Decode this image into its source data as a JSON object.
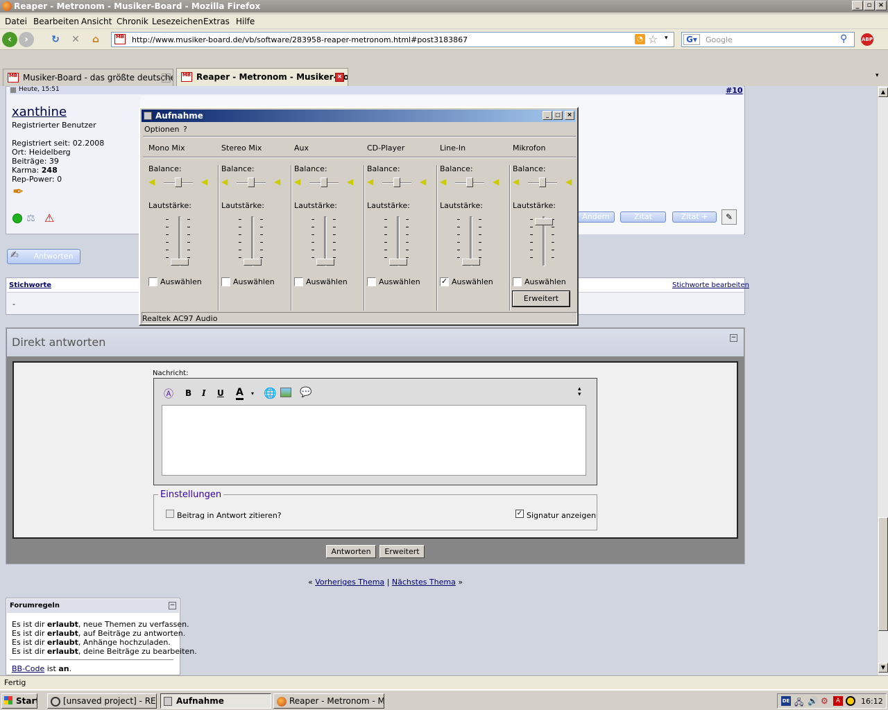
{
  "window": {
    "title": "Reaper - Metronom - Musiker-Board - Mozilla Firefox"
  },
  "menu": [
    "Datei",
    "Bearbeiten",
    "Ansicht",
    "Chronik",
    "Lesezeichen",
    "Extras",
    "Hilfe"
  ],
  "nav": {
    "url": "http://www.musiker-board.de/vb/software/283958-reaper-metronom.html#post3183867",
    "search_placeholder": "Google"
  },
  "tabs": [
    {
      "label": "Musiker-Board - das größte deutsche M...",
      "active": false
    },
    {
      "label": "Reaper - Metronom - Musiker-Bo...",
      "active": true
    }
  ],
  "post": {
    "date": "Heute, 15:51",
    "number": "#10",
    "username": "xanthine",
    "rank": "Registrierter Benutzer",
    "registered": "Registriert seit: 02.2008",
    "location": "Ort: Heidelberg",
    "posts": "Beiträge: 39",
    "karma_label": "Karma:",
    "karma_value": "248",
    "rep": "Rep-Power: 0",
    "buttons": {
      "edit": "Ändern",
      "quote": "Zitat",
      "quote_plus": "Zitat +"
    }
  },
  "reply_button": "Antworten",
  "tags": {
    "title": "Stichworte",
    "edit": "Stichworte bearbeiten",
    "value": "-"
  },
  "quick_reply": {
    "title": "Direkt antworten",
    "message_label": "Nachricht:",
    "settings_title": "Einstellungen",
    "quote_checkbox": "Beitrag in Antwort zitieren?",
    "signature_checkbox": "Signatur anzeigen",
    "submit": "Antworten",
    "advanced": "Erweitert",
    "toolbar": {
      "bold": "B",
      "italic": "I",
      "underline": "U",
      "color": "A"
    }
  },
  "thread_nav": {
    "prev": "Vorheriges Thema",
    "next": "Nächstes Thema",
    "open": "«",
    "sep": "|",
    "close": "»"
  },
  "forum_rules": {
    "title": "Forumregeln",
    "lines": [
      [
        "Es ist dir ",
        "erlaubt",
        ", neue Themen zu verfassen."
      ],
      [
        "Es ist dir ",
        "erlaubt",
        ", auf Beiträge zu antworten."
      ],
      [
        "Es ist dir ",
        "erlaubt",
        ", Anhänge hochzuladen."
      ],
      [
        "Es ist dir ",
        "erlaubt",
        ", deine Beiträge zu bearbeiten."
      ]
    ],
    "bbcode_link": "BB-Code",
    "bbcode_rest": " ist ",
    "bbcode_state": "an",
    "bbcode_end": "."
  },
  "dialog": {
    "title": "Aufnahme",
    "menu": [
      "Optionen",
      "?"
    ],
    "footer": "Realtek AC97 Audio",
    "balance_label": "Balance:",
    "volume_label": "Lautstärke:",
    "select_label": "Auswählen",
    "advanced_button": "Erweitert",
    "channels": [
      {
        "name": "Mono Mix",
        "selected": false,
        "level": 0.05
      },
      {
        "name": "Stereo Mix",
        "selected": false,
        "level": 0.05
      },
      {
        "name": "Aux",
        "selected": false,
        "level": 0.05
      },
      {
        "name": "CD-Player",
        "selected": false,
        "level": 0.05
      },
      {
        "name": "Line-In",
        "selected": true,
        "level": 0.05
      },
      {
        "name": "Mikrofon",
        "selected": false,
        "level": 0.95
      }
    ]
  },
  "status": "Fertig",
  "taskbar": {
    "start": "Start",
    "tasks": [
      "[unsaved project] - REA...",
      "Aufnahme",
      "Reaper - Metronom - Mu..."
    ],
    "clock": "16:12",
    "lang": "DE"
  }
}
